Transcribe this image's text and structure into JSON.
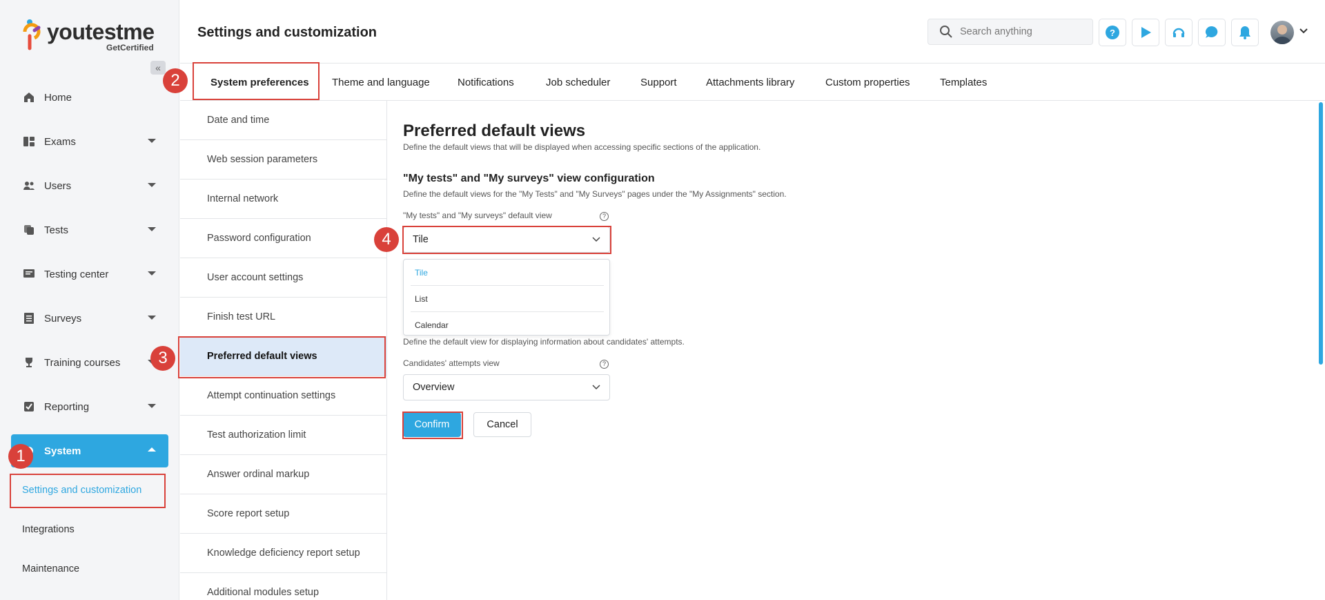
{
  "brand": {
    "name": "youtestme",
    "sub": "GetCertified"
  },
  "header": {
    "title": "Settings and customization",
    "search_placeholder": "Search anything"
  },
  "header_icons": [
    "help-icon",
    "play-icon",
    "headset-icon",
    "chat-icon",
    "bell-icon"
  ],
  "sidebar": {
    "items": [
      {
        "label": "Home",
        "icon": "home-icon"
      },
      {
        "label": "Exams",
        "icon": "exams-icon"
      },
      {
        "label": "Users",
        "icon": "users-icon"
      },
      {
        "label": "Tests",
        "icon": "tests-icon"
      },
      {
        "label": "Testing center",
        "icon": "testing-center-icon"
      },
      {
        "label": "Surveys",
        "icon": "surveys-icon"
      },
      {
        "label": "Training courses",
        "icon": "trophy-icon"
      },
      {
        "label": "Reporting",
        "icon": "reporting-icon"
      },
      {
        "label": "System",
        "icon": "gear-icon"
      }
    ],
    "sub_items": [
      {
        "label": "Settings and customization"
      },
      {
        "label": "Integrations"
      },
      {
        "label": "Maintenance"
      }
    ]
  },
  "tabs": [
    {
      "label": "System preferences"
    },
    {
      "label": "Theme and language"
    },
    {
      "label": "Notifications"
    },
    {
      "label": "Job scheduler"
    },
    {
      "label": "Support"
    },
    {
      "label": "Attachments library"
    },
    {
      "label": "Custom properties"
    },
    {
      "label": "Templates"
    }
  ],
  "settings_list": [
    {
      "label": "Date and time"
    },
    {
      "label": "Web session parameters"
    },
    {
      "label": "Internal network"
    },
    {
      "label": "Password configuration"
    },
    {
      "label": "User account settings"
    },
    {
      "label": "Finish test URL"
    },
    {
      "label": "Preferred default views"
    },
    {
      "label": "Attempt continuation settings"
    },
    {
      "label": "Test authorization limit"
    },
    {
      "label": "Answer ordinal markup"
    },
    {
      "label": "Score report setup"
    },
    {
      "label": "Knowledge deficiency report setup"
    },
    {
      "label": "Additional modules setup"
    }
  ],
  "main": {
    "title": "Preferred default views",
    "description": "Define the default views that will be displayed when accessing specific sections of the application.",
    "section1_title": "\"My tests\" and \"My surveys\" view configuration",
    "section1_desc": "Define the default views for the \"My Tests\" and \"My Surveys\" pages under the \"My Assignments\" section.",
    "field1_label": "\"My tests\" and \"My surveys\" default view",
    "field1_value": "Tile",
    "field1_options": [
      "Tile",
      "List",
      "Calendar"
    ],
    "section2_desc": "Define the default view for displaying information about candidates' attempts.",
    "field2_label": "Candidates' attempts view",
    "field2_value": "Overview",
    "confirm_label": "Confirm",
    "cancel_label": "Cancel"
  },
  "steps": [
    "1",
    "2",
    "3",
    "4"
  ],
  "colors": {
    "accent": "#2ea7e0",
    "highlight": "#d9413a",
    "active_row": "#dde9f8"
  }
}
